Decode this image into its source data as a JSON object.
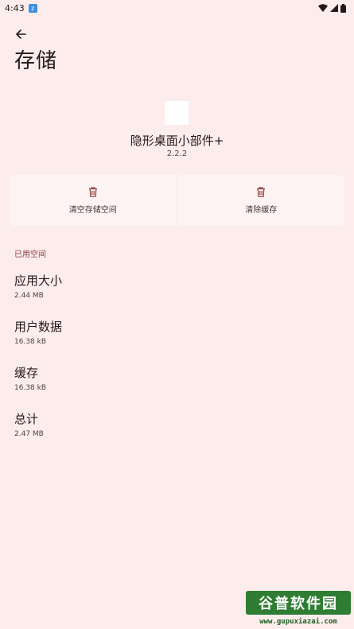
{
  "status_bar": {
    "time": "4:43"
  },
  "page": {
    "title": "存储"
  },
  "app": {
    "name": "隐形桌面小部件+",
    "version": "2.2.2"
  },
  "actions": [
    {
      "label": "清空存储空间",
      "icon": "trash-icon"
    },
    {
      "label": "清除缓存",
      "icon": "trash-icon"
    }
  ],
  "section": {
    "header": "已用空间"
  },
  "items": [
    {
      "title": "应用大小",
      "value": "2.44 MB"
    },
    {
      "title": "用户数据",
      "value": "16.38 kB"
    },
    {
      "title": "缓存",
      "value": "16.38 kB"
    },
    {
      "title": "总计",
      "value": "2.47 MB"
    }
  ],
  "watermark": {
    "brand": "谷普软件园",
    "url": "www.gupuxiazai.com"
  },
  "colors": {
    "background": "#fcecec",
    "accent": "#8e3d3d",
    "card": "#fdf3f3"
  }
}
